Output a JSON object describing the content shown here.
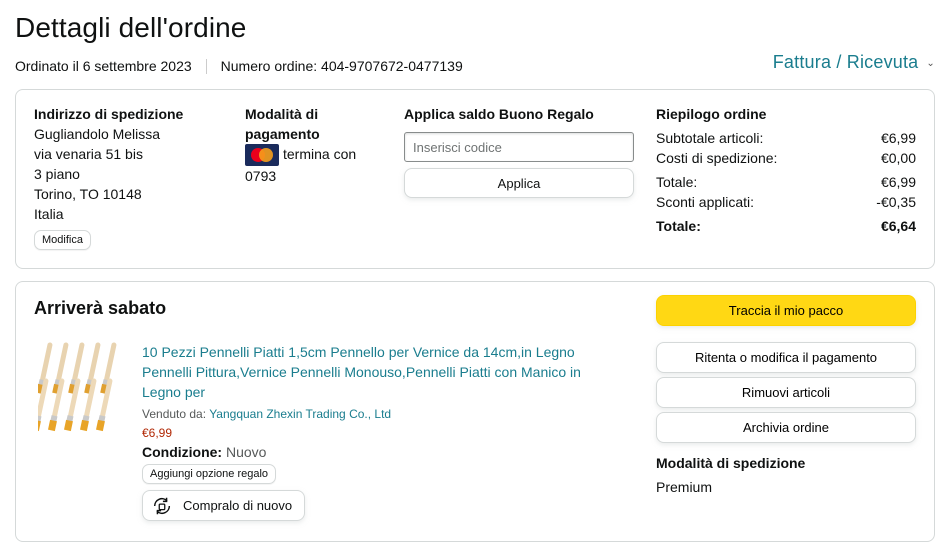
{
  "header": {
    "title": "Dettagli dell'ordine",
    "ordered": "Ordinato il 6 settembre 2023",
    "order_number": "Numero ordine: 404-9707672-0477139",
    "invoice_link": "Fattura / Ricevuta"
  },
  "shipping_address": {
    "heading": "Indirizzo di spedizione",
    "lines": [
      "Gugliandolo Melissa",
      "via venaria 51 bis",
      "3 piano",
      "Torino, TO 10148",
      "Italia"
    ],
    "edit_label": "Modifica"
  },
  "payment": {
    "heading_line1": "Modalità di",
    "heading_line2": "pagamento",
    "card_icon": "mastercard-icon",
    "ends_text": "termina con",
    "card_digits": "0793"
  },
  "gift_card": {
    "heading": "Applica saldo Buono Regalo",
    "placeholder": "Inserisci codice",
    "apply_label": "Applica"
  },
  "summary": {
    "heading": "Riepilogo ordine",
    "rows": [
      {
        "label": "Subtotale articoli:",
        "value": "€6,99"
      },
      {
        "label": "Costi di spedizione:",
        "value": "€0,00"
      },
      {
        "label": "Totale:",
        "value": "€6,99"
      },
      {
        "label": "Sconti applicati:",
        "value": "-€0,35"
      }
    ],
    "grand_total_label": "Totale:",
    "grand_total_value": "€6,64"
  },
  "shipment": {
    "arrival": "Arriverà sabato",
    "product_title": "10 Pezzi Pennelli Piatti 1,5cm Pennello per Vernice da 14cm,in Legno Pennelli Pittura,Vernice Pennelli Monouso,Pennelli Piatti con Manico in Legno per",
    "sold_by_label": "Venduto da:",
    "seller": "Yangquan Zhexin Trading Co., Ltd",
    "price": "€6,99",
    "condition_label": "Condizione:",
    "condition_value": "Nuovo",
    "gift_option_label": "Aggiungi opzione regalo",
    "buy_again_label": "Compralo di nuovo"
  },
  "actions": {
    "track": "Traccia il mio pacco",
    "retry_payment": "Ritenta o modifica il pagamento",
    "remove": "Rimuovi articoli",
    "archive": "Archivia ordine",
    "ship_mode_heading": "Modalità di spedizione",
    "ship_mode_value": "Premium"
  },
  "colors": {
    "link": "#1a7d8e",
    "price": "#b12704",
    "primary_button": "#ffd814"
  }
}
